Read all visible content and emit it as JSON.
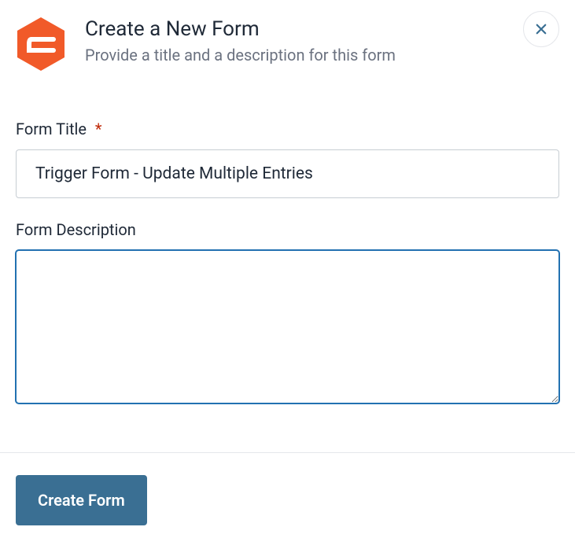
{
  "header": {
    "title": "Create a New Form",
    "subtitle": "Provide a title and a description for this form"
  },
  "fields": {
    "title": {
      "label": "Form Title",
      "required_marker": "*",
      "value": "Trigger Form - Update Multiple Entries"
    },
    "description": {
      "label": "Form Description",
      "value": ""
    }
  },
  "actions": {
    "create_label": "Create Form"
  },
  "colors": {
    "brand": "#f15a29",
    "primary_button": "#3a6f93",
    "close_icon": "#3a6f93"
  }
}
